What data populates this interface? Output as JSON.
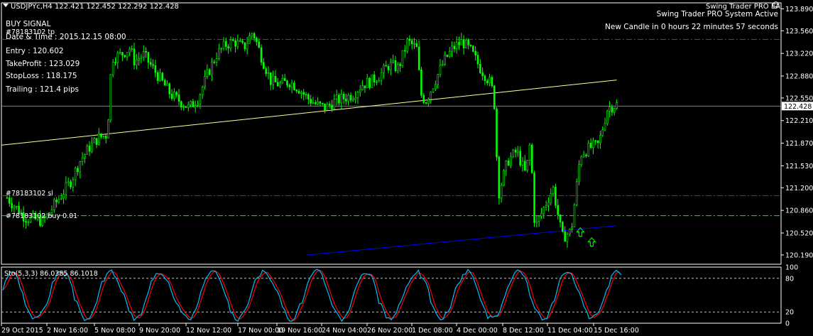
{
  "header": {
    "symbol_line": "USDJPYc,H4  122.421 122.452 122.292 122.428"
  },
  "ea": {
    "name": "Swing Trader PRO EA",
    "status": "Swing Trader PRO System Active",
    "candle_timer": "New Candle in 0 hours 22 minutes 57 seconds"
  },
  "signal": {
    "title": "BUY SIGNAL",
    "datetime": "Date & Time : 2015.12.15 08:00",
    "entry": "Entry : 120.602",
    "take_profit": "TakeProfit : 123.029",
    "stop_loss": "StopLoss : 118.175",
    "trailing": "Trailing : 121.4 pips"
  },
  "order_labels": {
    "tp": "#78183102 tp",
    "sl": "#78183102 sl",
    "buy": "#78183102 buy 0.01"
  },
  "colors": {
    "background": "#000000",
    "bull_candle": "#00ff00",
    "tp_line": "#ff0000",
    "sl_line": "#ff0000",
    "entry_line": "#00ff00",
    "trend_upper": "#ffff99",
    "trend_lower": "#0000ff",
    "stoch_main": "#00bfff",
    "stoch_signal": "#ff0000",
    "grid_text": "#ffffff"
  },
  "chart_data": [
    {
      "type": "candlestick",
      "symbol": "USDJPYc",
      "timeframe": "H4",
      "last_ohlc": {
        "open": 122.421,
        "high": 122.452,
        "low": 122.292,
        "close": 122.428
      },
      "current_price": "122.428",
      "y_ticks": [
        "123.890",
        "123.560",
        "123.220",
        "122.880",
        "122.550",
        "122.210",
        "121.870",
        "121.530",
        "121.200",
        "120.860",
        "120.520",
        "120.190"
      ],
      "ylim": [
        120.19,
        123.89
      ],
      "x_ticks": [
        "29 Oct 2015",
        "2 Nov 16:00",
        "5 Nov 08:00",
        "9 Nov 20:00",
        "12 Nov 12:00",
        "17 Nov 00:00",
        "19 Nov 16:00",
        "24 Nov 04:00",
        "26 Nov 20:00",
        "1 Dec 08:00",
        "4 Dec 00:00",
        "8 Dec 12:00",
        "11 Dec 04:00",
        "15 Dec 16:00"
      ],
      "close_path": [
        [
          0,
          121.05
        ],
        [
          4,
          120.75
        ],
        [
          8,
          120.7
        ],
        [
          10,
          120.9
        ],
        [
          12,
          121.1
        ],
        [
          14,
          121.3
        ],
        [
          16,
          121.6
        ],
        [
          18,
          121.8
        ],
        [
          20,
          121.95
        ],
        [
          22,
          122.0
        ],
        [
          23,
          123.15
        ],
        [
          25,
          123.2
        ],
        [
          27,
          123.3
        ],
        [
          28,
          123.1
        ],
        [
          30,
          123.2
        ],
        [
          32,
          123.0
        ],
        [
          34,
          122.8
        ],
        [
          36,
          122.6
        ],
        [
          38,
          122.5
        ],
        [
          40,
          122.4
        ],
        [
          42,
          122.55
        ],
        [
          44,
          122.9
        ],
        [
          46,
          123.2
        ],
        [
          48,
          123.35
        ],
        [
          50,
          123.4
        ],
        [
          52,
          123.3
        ],
        [
          54,
          123.55
        ],
        [
          56,
          123.15
        ],
        [
          58,
          122.8
        ],
        [
          60,
          122.75
        ],
        [
          62,
          122.8
        ],
        [
          64,
          122.7
        ],
        [
          66,
          122.55
        ],
        [
          68,
          122.45
        ],
        [
          70,
          122.4
        ],
        [
          72,
          122.5
        ],
        [
          74,
          122.55
        ],
        [
          76,
          122.6
        ],
        [
          78,
          122.75
        ],
        [
          80,
          122.8
        ],
        [
          82,
          122.9
        ],
        [
          84,
          123.05
        ],
        [
          86,
          123.0
        ],
        [
          88,
          123.4
        ],
        [
          90,
          123.3
        ],
        [
          91,
          122.6
        ],
        [
          92,
          122.5
        ],
        [
          94,
          122.8
        ],
        [
          96,
          123.1
        ],
        [
          98,
          123.3
        ],
        [
          100,
          123.4
        ],
        [
          102,
          123.25
        ],
        [
          104,
          123.0
        ],
        [
          106,
          122.8
        ],
        [
          107,
          122.6
        ],
        [
          108,
          121.1
        ],
        [
          110,
          121.6
        ],
        [
          112,
          121.75
        ],
        [
          114,
          121.4
        ],
        [
          115,
          121.9
        ],
        [
          116,
          120.6
        ],
        [
          118,
          120.9
        ],
        [
          120,
          121.2
        ],
        [
          122,
          120.45
        ],
        [
          124,
          120.55
        ],
        [
          126,
          121.7
        ],
        [
          128,
          121.8
        ],
        [
          130,
          121.85
        ],
        [
          132,
          122.4
        ],
        [
          134,
          122.45
        ]
      ],
      "horizontal_levels": [
        {
          "name": "take_profit",
          "value": 123.43,
          "style": "dash-dot",
          "color": "#ff0000"
        },
        {
          "name": "stop_loss",
          "value": 121.08,
          "style": "dash-dot",
          "color": "#ff0000"
        },
        {
          "name": "entry",
          "value": 120.78,
          "style": "dash-dot",
          "color": "#00ff00"
        },
        {
          "name": "current_price",
          "value": 122.428,
          "style": "solid",
          "color": "#808080"
        }
      ],
      "trend_lines": [
        {
          "name": "upper",
          "from": [
            0,
            121.85
          ],
          "to": [
            134,
            122.82
          ],
          "color": "#ffff99"
        },
        {
          "name": "lower",
          "from": [
            66,
            120.19
          ],
          "to": [
            134,
            120.63
          ],
          "color": "#0000ff"
        }
      ]
    },
    {
      "type": "line",
      "indicator": "Stochastic",
      "label": "Sto(5,3,3) 86.0385 86.1018",
      "params": [
        5,
        3,
        3
      ],
      "main_value": 86.0385,
      "signal_value": 86.1018,
      "ylim": [
        0,
        100
      ],
      "y_ticks": [
        "100",
        "80",
        "20",
        "0"
      ],
      "levels": [
        80,
        20
      ]
    }
  ]
}
